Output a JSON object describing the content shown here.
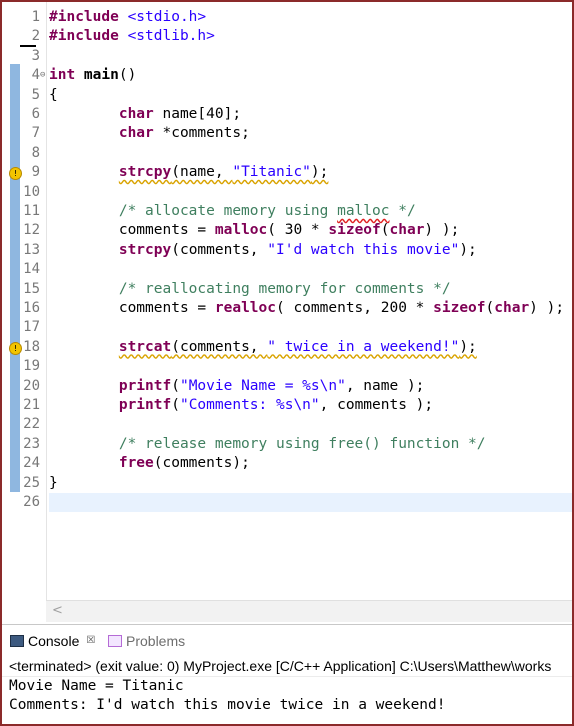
{
  "editor": {
    "lines": [
      {
        "n": "1",
        "segs": [
          {
            "t": "#include ",
            "c": "kw"
          },
          {
            "t": "<stdio.h>",
            "c": "str"
          }
        ]
      },
      {
        "n": "2",
        "segs": [
          {
            "t": "#include ",
            "c": "kw"
          },
          {
            "t": "<stdlib.h>",
            "c": "str"
          }
        ]
      },
      {
        "n": "3",
        "segs": []
      },
      {
        "n": "4",
        "fold": "⊖",
        "segs": [
          {
            "t": "int ",
            "c": "kw"
          },
          {
            "t": "main",
            "c": "kwb"
          },
          {
            "t": "()",
            "c": ""
          }
        ]
      },
      {
        "n": "5",
        "segs": [
          {
            "t": "{",
            "c": ""
          }
        ]
      },
      {
        "n": "6",
        "segs": [
          {
            "t": "        ",
            "c": ""
          },
          {
            "t": "char",
            "c": "kw"
          },
          {
            "t": " name[40];",
            "c": ""
          }
        ]
      },
      {
        "n": "7",
        "segs": [
          {
            "t": "        ",
            "c": ""
          },
          {
            "t": "char",
            "c": "kw"
          },
          {
            "t": " *comments;",
            "c": ""
          }
        ]
      },
      {
        "n": "8",
        "segs": []
      },
      {
        "n": "9",
        "warn": true,
        "segs": [
          {
            "t": "        ",
            "c": ""
          },
          {
            "t": "strcpy",
            "c": "kw sq"
          },
          {
            "t": "(name, ",
            "c": "sq"
          },
          {
            "t": "\"Titanic\"",
            "c": "str sq"
          },
          {
            "t": ");",
            "c": "sq"
          }
        ]
      },
      {
        "n": "10",
        "segs": []
      },
      {
        "n": "11",
        "segs": [
          {
            "t": "        ",
            "c": ""
          },
          {
            "t": "/* allocate memory using ",
            "c": "cmt"
          },
          {
            "t": "malloc",
            "c": "cmt sqr"
          },
          {
            "t": " */",
            "c": "cmt"
          }
        ]
      },
      {
        "n": "12",
        "segs": [
          {
            "t": "        comments = ",
            "c": ""
          },
          {
            "t": "malloc",
            "c": "kw"
          },
          {
            "t": "( 30 * ",
            "c": ""
          },
          {
            "t": "sizeof",
            "c": "kw"
          },
          {
            "t": "(",
            "c": ""
          },
          {
            "t": "char",
            "c": "kw"
          },
          {
            "t": ") );",
            "c": ""
          }
        ]
      },
      {
        "n": "13",
        "segs": [
          {
            "t": "        ",
            "c": ""
          },
          {
            "t": "strcpy",
            "c": "kw"
          },
          {
            "t": "(comments, ",
            "c": ""
          },
          {
            "t": "\"I'd watch this movie\"",
            "c": "str"
          },
          {
            "t": ");",
            "c": ""
          }
        ]
      },
      {
        "n": "14",
        "segs": []
      },
      {
        "n": "15",
        "segs": [
          {
            "t": "        ",
            "c": ""
          },
          {
            "t": "/* reallocating memory for comments */",
            "c": "cmt"
          }
        ]
      },
      {
        "n": "16",
        "segs": [
          {
            "t": "        comments = ",
            "c": ""
          },
          {
            "t": "realloc",
            "c": "kw"
          },
          {
            "t": "( comments, 200 * ",
            "c": ""
          },
          {
            "t": "sizeof",
            "c": "kw"
          },
          {
            "t": "(",
            "c": ""
          },
          {
            "t": "char",
            "c": "kw"
          },
          {
            "t": ") );",
            "c": ""
          }
        ]
      },
      {
        "n": "17",
        "segs": []
      },
      {
        "n": "18",
        "warn": true,
        "segs": [
          {
            "t": "        ",
            "c": ""
          },
          {
            "t": "strcat",
            "c": "kw sq"
          },
          {
            "t": "(comments, ",
            "c": "sq"
          },
          {
            "t": "\" twice in a weekend!\"",
            "c": "str sq"
          },
          {
            "t": ");",
            "c": "sq"
          }
        ]
      },
      {
        "n": "19",
        "segs": []
      },
      {
        "n": "20",
        "segs": [
          {
            "t": "        ",
            "c": ""
          },
          {
            "t": "printf",
            "c": "kw"
          },
          {
            "t": "(",
            "c": ""
          },
          {
            "t": "\"Movie Name = %s\\n\"",
            "c": "str"
          },
          {
            "t": ", name );",
            "c": ""
          }
        ]
      },
      {
        "n": "21",
        "segs": [
          {
            "t": "        ",
            "c": ""
          },
          {
            "t": "printf",
            "c": "kw"
          },
          {
            "t": "(",
            "c": ""
          },
          {
            "t": "\"Comments: %s\\n\"",
            "c": "str"
          },
          {
            "t": ", comments );",
            "c": ""
          }
        ]
      },
      {
        "n": "22",
        "segs": []
      },
      {
        "n": "23",
        "segs": [
          {
            "t": "        ",
            "c": ""
          },
          {
            "t": "/* release memory using free() function */",
            "c": "cmt"
          }
        ]
      },
      {
        "n": "24",
        "segs": [
          {
            "t": "        ",
            "c": ""
          },
          {
            "t": "free",
            "c": "kw"
          },
          {
            "t": "(comments);",
            "c": ""
          }
        ]
      },
      {
        "n": "25",
        "segs": [
          {
            "t": "}",
            "c": ""
          }
        ]
      },
      {
        "n": "26",
        "current": true,
        "segs": []
      }
    ],
    "scroll_left_glyph": "<"
  },
  "console": {
    "tabs": {
      "console_label": "Console",
      "close_glyph": "☒",
      "problems_label": "Problems"
    },
    "status": "<terminated> (exit value: 0) MyProject.exe [C/C++ Application] C:\\Users\\Matthew\\works",
    "output": [
      "Movie Name = Titanic",
      "Comments: I'd watch this movie twice in a weekend!"
    ]
  },
  "colors": {
    "keyword": "#7f0055",
    "string": "#2a00ff",
    "comment": "#3f7f5f",
    "ruler_blue": "#6a9fd6",
    "warning_yellow": "#f2c400",
    "frame_border": "#8b2a2a"
  }
}
